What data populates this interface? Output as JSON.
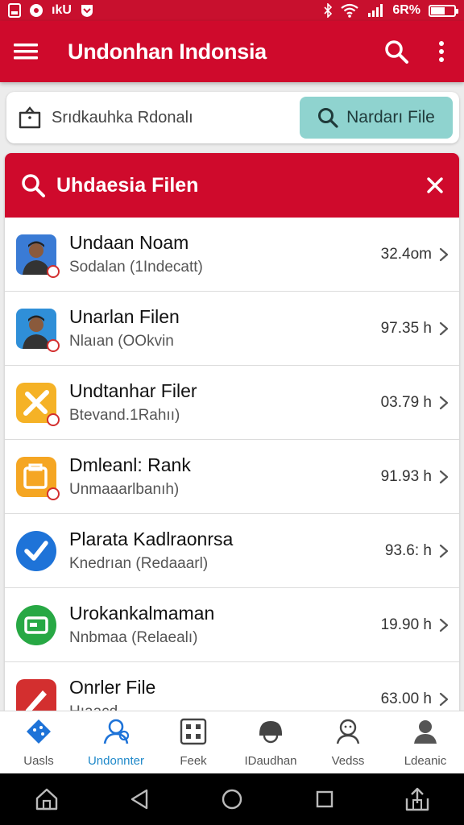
{
  "status_bar": {
    "left_text": "ıkU",
    "battery_text": "6R%",
    "battery_level": 0.62
  },
  "app_bar": {
    "title": "Undonhan Indonsia",
    "menu_icon": "hamburger-icon",
    "search_icon": "search-icon",
    "more_icon": "more-vert-icon"
  },
  "search_card": {
    "field_text": "Srıdkauhka Rdonalı",
    "button_label": "Nardarı File",
    "button_color": "#8fd3cf"
  },
  "results": {
    "title": "Uhdaesia Filen",
    "accent": "#cf0a2c",
    "items": [
      {
        "title": "Undaan Noam",
        "subtitle": "Sodalan (1Indecatt)",
        "size": "32.4om",
        "icon": "person-photo-icon",
        "icon_color": "#3a7bd5"
      },
      {
        "title": "Unarlan Filen",
        "subtitle": "Nlaıan (OOkvin",
        "size": "97.35 h",
        "icon": "person-photo-icon",
        "icon_color": "#2f8fd8"
      },
      {
        "title": "Undtanhar Filer",
        "subtitle": "Btevand.1Rahıı)",
        "size": "03.79 h",
        "icon": "tools-icon",
        "icon_color": "#f5b226"
      },
      {
        "title": "Dmleanl: Rank",
        "subtitle": "Unmaaarlbanıh)",
        "size": "91.93 h",
        "icon": "briefcase-icon",
        "icon_color": "#f5a623"
      },
      {
        "title": "Plarata Kadlraonrsa",
        "subtitle": "Knedrıan (Redaaarl)",
        "size": "93.6: h",
        "icon": "check-icon",
        "icon_color": "#1e73d8"
      },
      {
        "title": "Urokankalmaman",
        "subtitle": "Nnbmaa (Relaealı)",
        "size": "19.90 h",
        "icon": "card-icon",
        "icon_color": "#27a844"
      },
      {
        "title": "Onrler File",
        "subtitle": "Hıaacd",
        "size": "63.00 h",
        "icon": "pen-icon",
        "icon_color": "#d32f2f"
      }
    ]
  },
  "bottom_nav": {
    "items": [
      {
        "label": "Uasls",
        "icon": "map-icon",
        "active": false
      },
      {
        "label": "Undonnter",
        "icon": "people-icon",
        "active": true
      },
      {
        "label": "Feek",
        "icon": "grid-icon",
        "active": false
      },
      {
        "label": "IDaudhan",
        "icon": "helmet-icon",
        "active": false
      },
      {
        "label": "Vedss",
        "icon": "smiley-icon",
        "active": false
      },
      {
        "label": "Ldeanic",
        "icon": "profile-icon",
        "active": false
      }
    ]
  },
  "system_nav": [
    "home-icon",
    "back-icon",
    "circle-home-icon",
    "recents-icon",
    "share-icon"
  ]
}
